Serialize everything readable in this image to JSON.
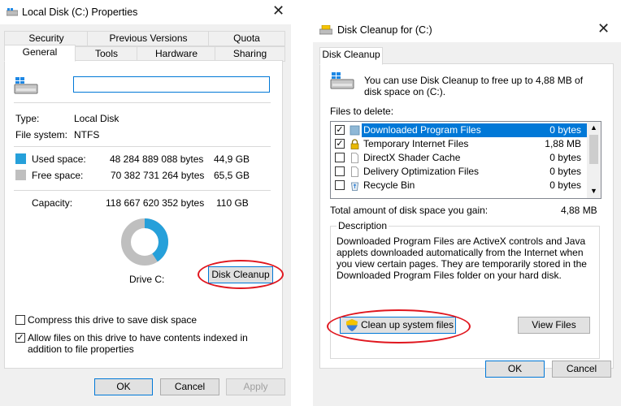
{
  "properties": {
    "title": "Local Disk (C:) Properties",
    "tabs_top": [
      "Security",
      "Previous Versions",
      "Quota"
    ],
    "tabs_bottom": [
      "General",
      "Tools",
      "Hardware",
      "Sharing"
    ],
    "drive_name_value": "",
    "type_label": "Type:",
    "type_value": "Local Disk",
    "fs_label": "File system:",
    "fs_value": "NTFS",
    "used_label": "Used space:",
    "used_bytes": "48 284 889 088 bytes",
    "used_size": "44,9 GB",
    "free_label": "Free space:",
    "free_bytes": "70 382 731 264 bytes",
    "free_size": "65,5 GB",
    "capacity_label": "Capacity:",
    "capacity_bytes": "118 667 620 352 bytes",
    "capacity_size": "110 GB",
    "used_fraction": 0.407,
    "drive_label": "Drive C:",
    "disk_cleanup_button": "Disk Cleanup",
    "compress_label": "Compress this drive to save disk space",
    "compress_checked": false,
    "index_label": "Allow files on this drive to have contents indexed in addition to file properties",
    "index_checked": true,
    "ok": "OK",
    "cancel": "Cancel",
    "apply": "Apply",
    "colors": {
      "used": "#26a0da",
      "free": "#bfbfbf",
      "accent": "#0078d7"
    }
  },
  "cleanup": {
    "title": "Disk Cleanup for  (C:)",
    "tab": "Disk Cleanup",
    "intro": "You can use Disk Cleanup to free up to 4,88 MB of disk space on  (C:).",
    "files_to_delete_label": "Files to delete:",
    "files": [
      {
        "name": "Downloaded Program Files",
        "size": "0 bytes",
        "checked": true,
        "selected": true,
        "icon": "folder-icon"
      },
      {
        "name": "Temporary Internet Files",
        "size": "1,88 MB",
        "checked": true,
        "selected": false,
        "icon": "lock-icon"
      },
      {
        "name": "DirectX Shader Cache",
        "size": "0 bytes",
        "checked": false,
        "selected": false,
        "icon": "file-icon"
      },
      {
        "name": "Delivery Optimization Files",
        "size": "0 bytes",
        "checked": false,
        "selected": false,
        "icon": "file-icon"
      },
      {
        "name": "Recycle Bin",
        "size": "0 bytes",
        "checked": false,
        "selected": false,
        "icon": "recycle-bin-icon"
      }
    ],
    "total_label": "Total amount of disk space you gain:",
    "total_value": "4,88 MB",
    "description_label": "Description",
    "description_text": "Downloaded Program Files are ActiveX controls and Java applets downloaded automatically from the Internet when you view certain pages. They are temporarily stored in the Downloaded Program Files folder on your hard disk.",
    "clean_system_button": "Clean up system files",
    "view_files_button": "View Files",
    "ok": "OK",
    "cancel": "Cancel"
  }
}
